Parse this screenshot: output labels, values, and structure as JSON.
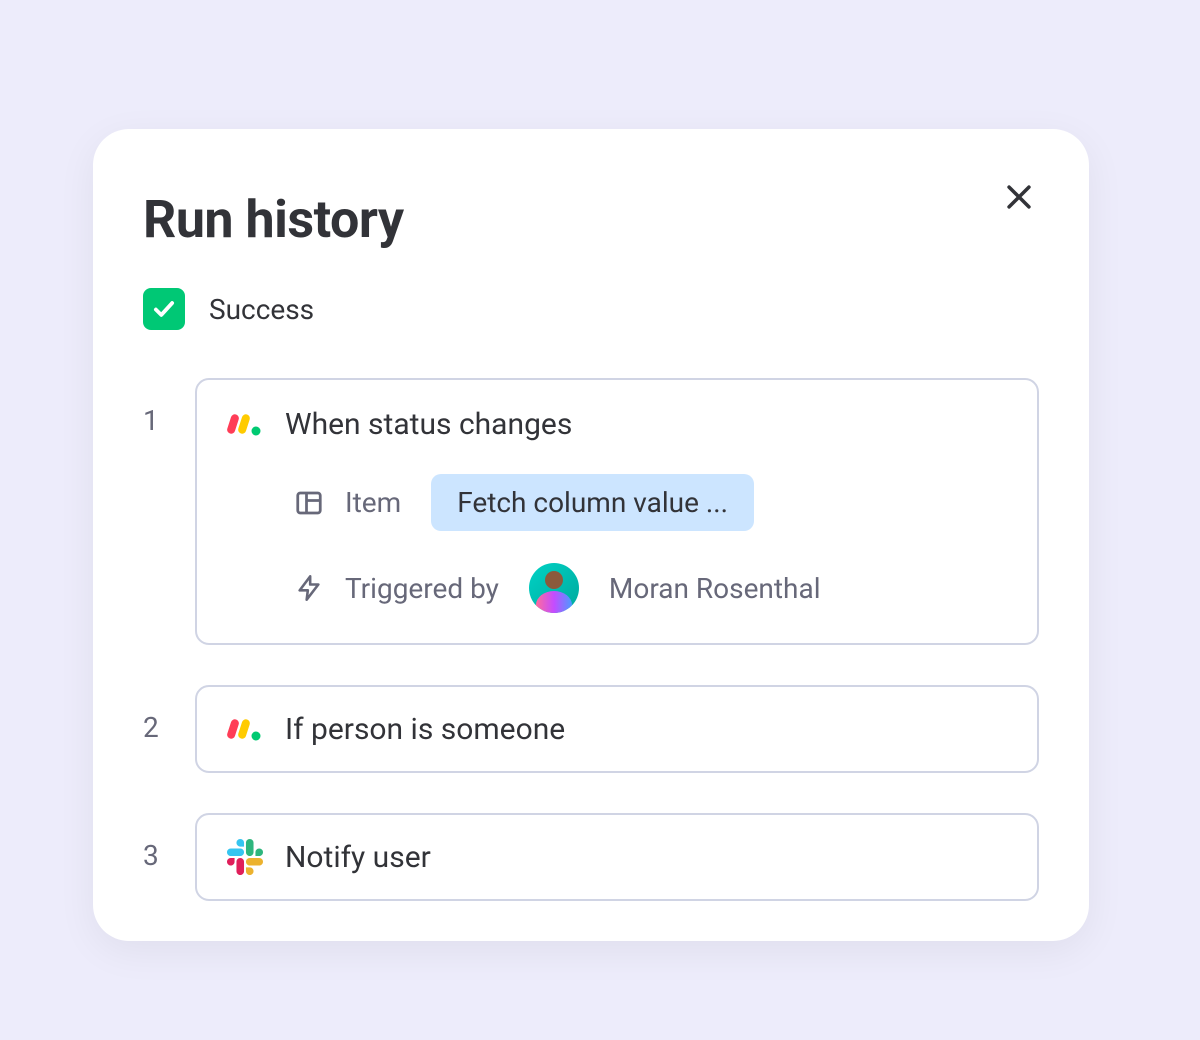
{
  "modal": {
    "title": "Run history",
    "status": {
      "label": "Success"
    },
    "steps": [
      {
        "number": "1",
        "app": "monday",
        "title": "When status changes",
        "details": {
          "item_label": "Item",
          "item_value": "Fetch column value ...",
          "triggered_label": "Triggered by",
          "triggered_user": "Moran Rosenthal"
        }
      },
      {
        "number": "2",
        "app": "monday",
        "title": "If person is someone"
      },
      {
        "number": "3",
        "app": "slack",
        "title": "Notify user"
      }
    ]
  }
}
